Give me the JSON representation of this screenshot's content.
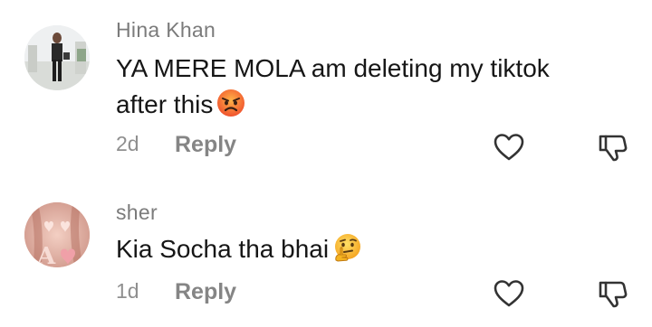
{
  "comments": [
    {
      "username": "Hina Khan",
      "text_lines": [
        "YA MERE MOLA am deleting my tiktok",
        "after this"
      ],
      "emoji": "angry-face-emoji",
      "timestamp": "2d",
      "reply_label": "Reply"
    },
    {
      "username": "sher",
      "text_lines": [
        "Kia Socha tha bhai"
      ],
      "emoji": "thinking-face-emoji",
      "timestamp": "1d",
      "reply_label": "Reply"
    }
  ],
  "icons": {
    "like": "heart-icon",
    "dislike": "thumbs-down-icon"
  },
  "colors": {
    "username": "#7b7b7b",
    "text": "#161616",
    "meta": "#8f8f8f",
    "reply": "#858585",
    "icon_stroke": "#333333"
  }
}
